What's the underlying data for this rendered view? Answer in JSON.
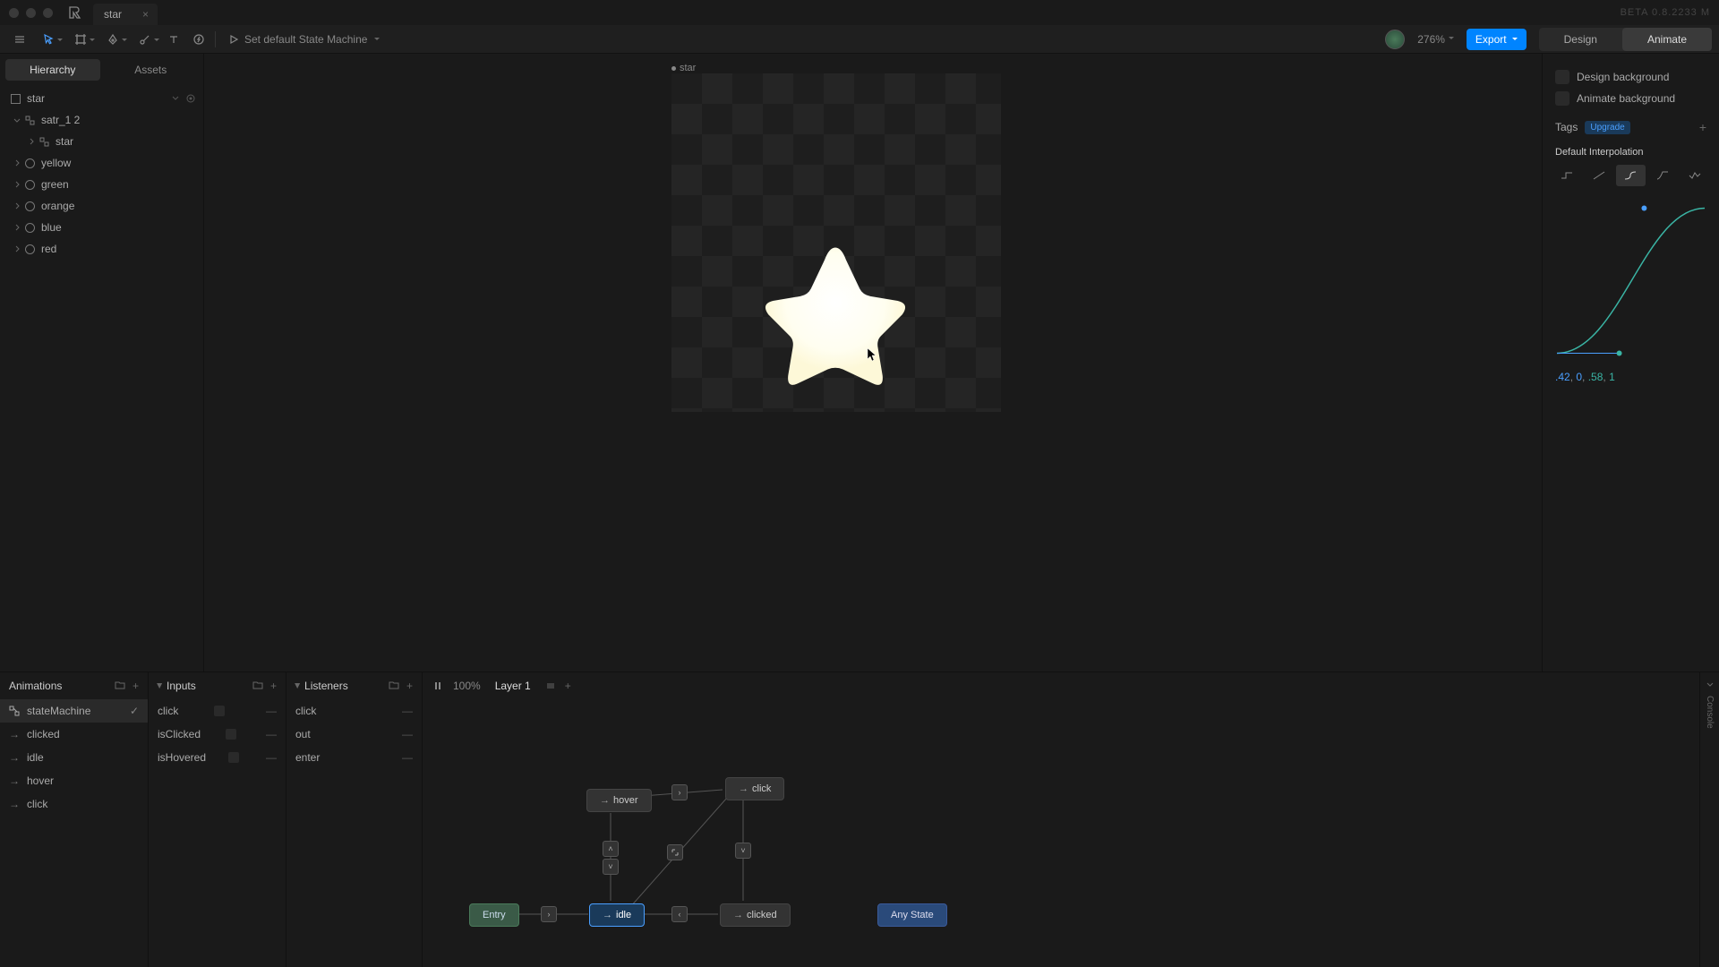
{
  "app": {
    "beta": "BETA 0.8.2233 M",
    "tab_title": "star"
  },
  "toolbar": {
    "state_machine_label": "Set default State Machine",
    "zoom": "276%",
    "export": "Export",
    "mode_design": "Design",
    "mode_animate": "Animate"
  },
  "left_panel": {
    "tab_hierarchy": "Hierarchy",
    "tab_assets": "Assets",
    "items": [
      {
        "label": "star",
        "indent": 0,
        "type": "artboard"
      },
      {
        "label": "satr_1 2",
        "indent": 1,
        "type": "group"
      },
      {
        "label": "star",
        "indent": 2,
        "type": "group"
      },
      {
        "label": "yellow",
        "indent": 1,
        "type": "circle"
      },
      {
        "label": "green",
        "indent": 1,
        "type": "circle"
      },
      {
        "label": "orange",
        "indent": 1,
        "type": "circle"
      },
      {
        "label": "blue",
        "indent": 1,
        "type": "circle"
      },
      {
        "label": "red",
        "indent": 1,
        "type": "circle"
      }
    ]
  },
  "canvas": {
    "artboard_label": "star"
  },
  "right_panel": {
    "design_bg": "Design background",
    "animate_bg": "Animate background",
    "tags_label": "Tags",
    "upgrade": "Upgrade",
    "default_interp": "Default Interpolation",
    "bezier": {
      "a": ".42",
      "b": "0",
      "c": ".58",
      "d": "1"
    }
  },
  "bottom": {
    "animations_header": "Animations",
    "inputs_header": "Inputs",
    "listeners_header": "Listeners",
    "layer_label": "Layer 1",
    "graph_zoom": "100%",
    "console": "Console",
    "animations": [
      {
        "label": "stateMachine",
        "type": "sm",
        "selected": true
      },
      {
        "label": "clicked",
        "type": "anim"
      },
      {
        "label": "idle",
        "type": "anim"
      },
      {
        "label": "hover",
        "type": "anim"
      },
      {
        "label": "click",
        "type": "anim"
      }
    ],
    "inputs": [
      {
        "label": "click"
      },
      {
        "label": "isClicked"
      },
      {
        "label": "isHovered"
      }
    ],
    "listeners": [
      {
        "label": "click"
      },
      {
        "label": "out"
      },
      {
        "label": "enter"
      }
    ],
    "states": {
      "entry": "Entry",
      "idle": "idle",
      "hover": "hover",
      "click": "click",
      "clicked": "clicked",
      "any": "Any State"
    }
  }
}
